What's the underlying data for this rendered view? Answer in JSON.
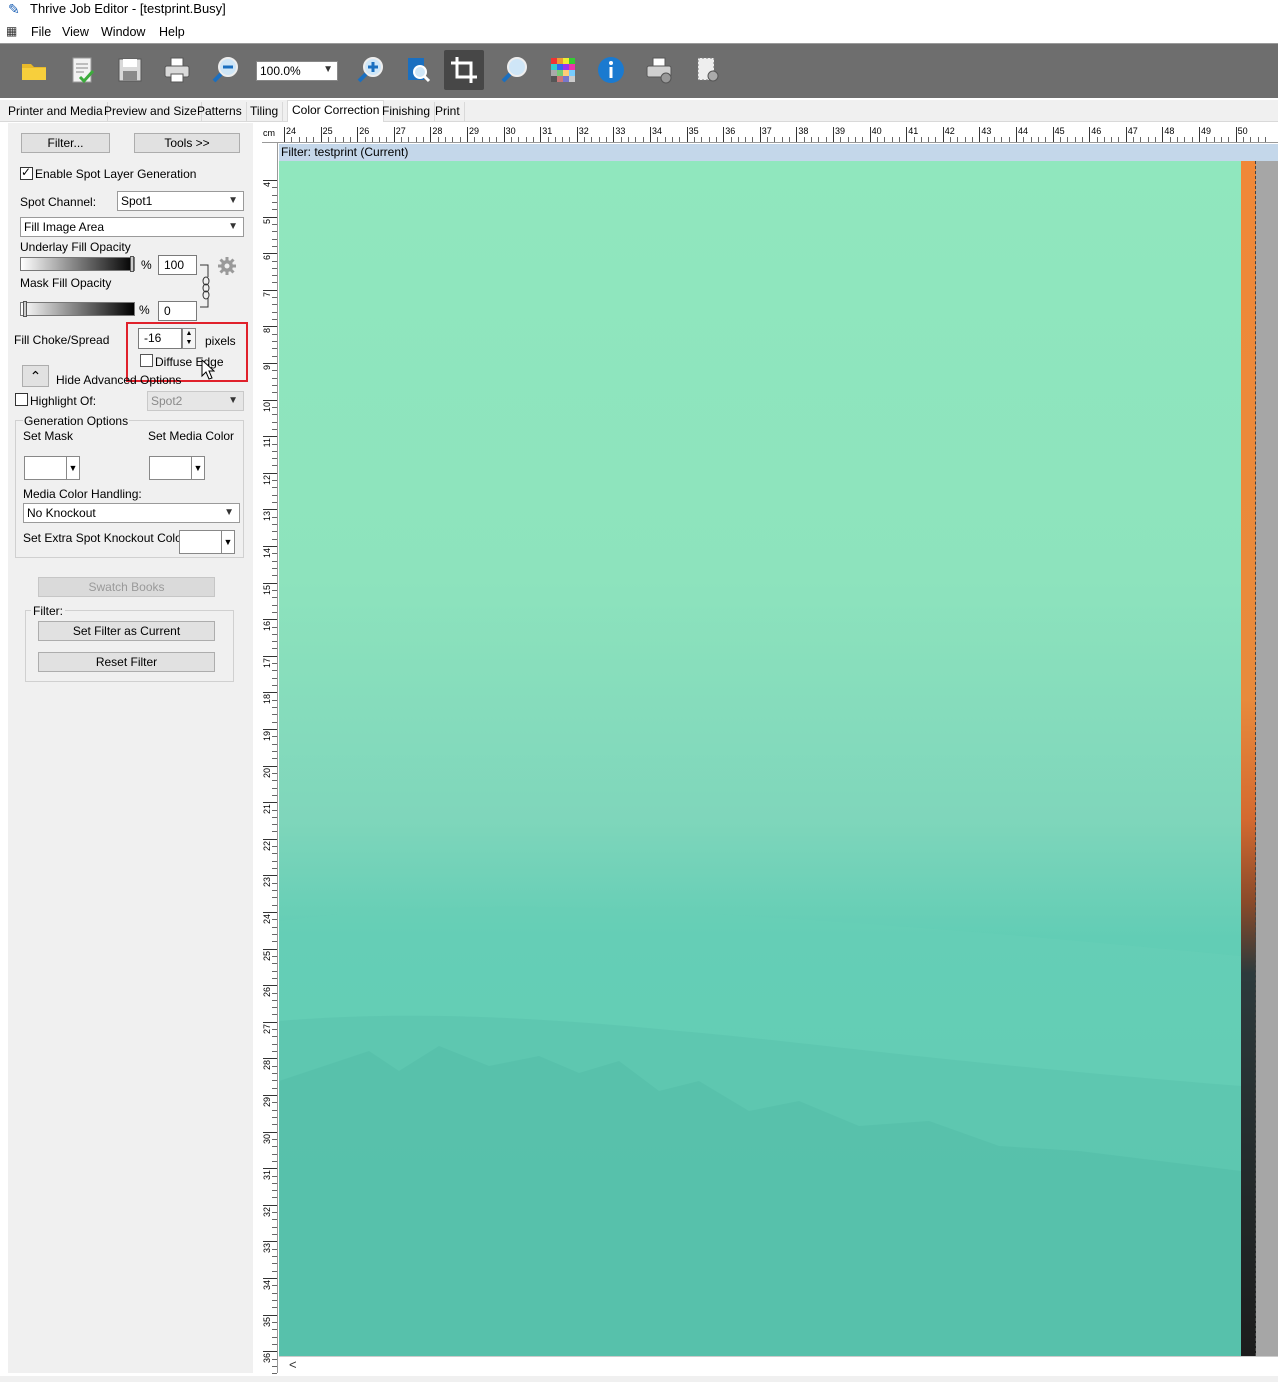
{
  "window": {
    "title": "Thrive Job Editor - [testprint.Busy]"
  },
  "menu": {
    "items": [
      "File",
      "View",
      "Window",
      "Help"
    ]
  },
  "toolbar": {
    "zoom_value": "100.0%",
    "buttons": [
      "open-folder-icon",
      "checklist-icon",
      "save-icon",
      "print-icon",
      "zoom-out-icon",
      "zoom-in-icon",
      "zoom-page-icon",
      "crop-icon",
      "magnifier-icon",
      "color-grid-icon",
      "info-icon",
      "printer-settings-icon",
      "page-setup-icon"
    ]
  },
  "tabs": [
    "Printer and Media",
    "Preview and Size",
    "Patterns",
    "Tiling",
    "Color Correction",
    "Finishing",
    "Print"
  ],
  "active_tab": "Color Correction",
  "panel": {
    "filter_button": "Filter...",
    "tools_button": "Tools >>",
    "enable_spot_label": "Enable Spot Layer Generation",
    "enable_spot_checked": true,
    "spot_channel_label": "Spot Channel:",
    "spot_channel_value": "Spot1",
    "fill_mode_value": "Fill Image Area",
    "underlay_label": "Underlay Fill Opacity",
    "underlay_value": "100",
    "underlay_level": 1.0,
    "percent": "%",
    "mask_label": "Mask Fill Opacity",
    "mask_value": "0",
    "mask_level": 0.0,
    "choke_label": "Fill Choke/Spread",
    "choke_value": "-16",
    "pixels_label": "pixels",
    "diffuse_label": "Diffuse Edge",
    "diffuse_checked": false,
    "hide_advanced_label": "Hide Advanced Options",
    "highlight_label": "Highlight Of:",
    "highlight_checked": false,
    "highlight_value": "Spot2",
    "generation_options_label": "Generation Options",
    "set_mask_label": "Set Mask",
    "set_media_color_label": "Set Media Color",
    "media_color_handling_label": "Media Color Handling:",
    "media_color_handling_value": "No Knockout",
    "extra_spot_label": "Set Extra Spot Knockout Color",
    "swatch_books_button": "Swatch Books",
    "filter_group_label": "Filter:",
    "set_filter_button": "Set Filter as Current",
    "reset_filter_button": "Reset Filter"
  },
  "canvas": {
    "ruler_unit": "cm",
    "ruler_top_labels": [
      "24",
      "25",
      "26",
      "27",
      "28",
      "29",
      "30",
      "31",
      "32",
      "33",
      "34",
      "35",
      "36",
      "37",
      "38",
      "39",
      "40",
      "41",
      "42",
      "43",
      "44",
      "45",
      "46",
      "47",
      "48",
      "49",
      "50"
    ],
    "ruler_left_labels": [
      "4",
      "5",
      "6",
      "7",
      "8",
      "9",
      "10",
      "11",
      "12",
      "13",
      "14",
      "15",
      "16",
      "17",
      "18",
      "19",
      "20",
      "21",
      "22",
      "23",
      "24",
      "25",
      "26",
      "27",
      "28",
      "29",
      "30",
      "31",
      "32",
      "33",
      "34",
      "35",
      "36"
    ],
    "filter_header": "Filter: testprint (Current)"
  },
  "colors": {
    "toolbar_bg": "#6e6e6e",
    "highlight_red": "#e0212b",
    "header_blue": "#c4d7ea",
    "image_teal": "#5bc6b0",
    "image_mint": "#90e7be"
  }
}
